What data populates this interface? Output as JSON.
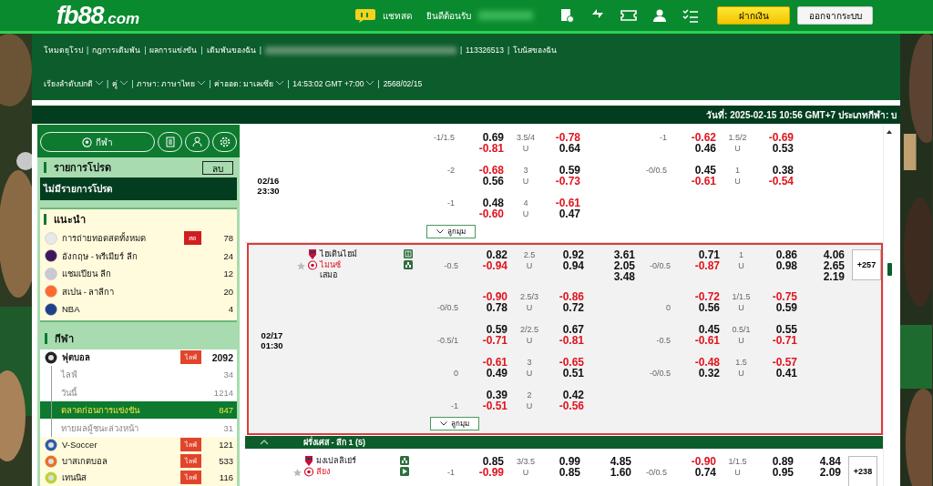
{
  "header": {
    "logo": "fb88",
    "logo_suffix": ".com",
    "chat": "แชทสด",
    "welcome": "ยินดีต้อนรับ",
    "buttons": [
      {
        "label": "ฝากเงิน",
        "kind": "primary"
      },
      {
        "label": "ออกจากระบบ",
        "kind": "plain"
      }
    ]
  },
  "info_bar": {
    "separator": "|",
    "links": [
      {
        "label": "โหมดยุโรป",
        "kind": "link"
      },
      {
        "label": "กฎการเดิมพัน",
        "kind": "link"
      },
      {
        "label": "ผลการแข่งขัน",
        "kind": "link"
      },
      {
        "label": "เดิมพันของฉัน",
        "kind": "link"
      },
      {
        "kind": "blurred"
      },
      {
        "label": "113326513",
        "kind": "link"
      },
      {
        "label": "โบนัสของฉัน",
        "kind": "link"
      }
    ],
    "settings": [
      {
        "label": "เรียงลำดับปกติ",
        "kind": "dropdown"
      },
      {
        "label": "คู่",
        "kind": "dropdown"
      },
      {
        "label": "ภาษา: ภาษาไทย",
        "kind": "dropdown"
      },
      {
        "label": "ค่าออด: มาเลเซีย",
        "kind": "dropdown"
      },
      {
        "label": "14:53:02 GMT +7:00",
        "kind": "dropdown"
      },
      {
        "label": "2568/02/15",
        "kind": "text"
      }
    ]
  },
  "date_bar": "วันที่: 2025-02-15 10:56 GMT+7 ประเภทกีฬา: บ",
  "sidebar": {
    "sports_button": "กีฬา",
    "favorites": {
      "title": "รายการโปรด",
      "clear_button": "ลบ",
      "empty_text": "ไม่มีรายการโปรด"
    },
    "recommended": {
      "title": "แนะนำ",
      "items": [
        {
          "name": "การถ่ายทอดสดทั้งหมด",
          "count": "78",
          "badge": "สด"
        },
        {
          "name": "อังกฤษ - พรีเมียร์ ลีก",
          "count": "24"
        },
        {
          "name": "แชมเปียน ลีก",
          "count": "12"
        },
        {
          "name": "สเปน - ลาลีกา",
          "count": "20"
        },
        {
          "name": "NBA",
          "count": "4"
        }
      ]
    },
    "sports": {
      "title": "กีฬา",
      "items": [
        {
          "name": "ฟุตบอล",
          "count": "2092",
          "badge": "ไลฟ์",
          "expanded": true,
          "children": [
            {
              "name": "ไลฟ์",
              "count": "34",
              "selected": false
            },
            {
              "name": "วันนี้",
              "count": "1214",
              "selected": false
            },
            {
              "name": "ตลาดก่อนการแข่งขัน",
              "count": "847",
              "selected": true
            },
            {
              "name": "ทายผลผู้ชนะล่วงหน้า",
              "count": "31",
              "selected": false
            }
          ]
        },
        {
          "name": "V-Soccer",
          "count": "121",
          "badge": "ไลฟ์",
          "expanded": false
        },
        {
          "name": "บาสเกตบอล",
          "count": "533",
          "badge": "ไลฟ์",
          "expanded": false
        },
        {
          "name": "เทนนิส",
          "count": "116",
          "badge": "ไลฟ์",
          "expanded": false
        }
      ]
    }
  },
  "main": {
    "items": [
      {
        "kind": "match",
        "date": "02/16",
        "time": "23:30",
        "away_favoured": false,
        "highlighted": false,
        "more_markets": "ลูกมุม",
        "lines": [
          {
            "hdp": "-1/1.5",
            "odds": [
              "0.69",
              "-0.81"
            ],
            "ou": "3.5/4",
            "ou_side": "U",
            "ou_odds": [
              "-0.78",
              "0.64"
            ],
            "h1_hdp": "-1",
            "h1_odds": [
              "-0.62",
              "0.46"
            ],
            "h1_ou": "1.5/2",
            "h1_ou_side": "U",
            "h1_ou_odds": [
              "-0.69",
              "0.53"
            ]
          },
          {
            "hdp": "-2",
            "odds": [
              "-0.68",
              "0.56"
            ],
            "ou": "3",
            "ou_side": "U",
            "ou_odds": [
              "0.59",
              "-0.73"
            ],
            "h1_hdp": "-0/0.5",
            "h1_odds": [
              "0.45",
              "-0.61"
            ],
            "h1_ou": "1",
            "h1_ou_side": "U",
            "h1_ou_odds": [
              "0.38",
              "-0.54"
            ]
          },
          {
            "hdp": "-1",
            "odds": [
              "0.48",
              "-0.60"
            ],
            "ou": "4",
            "ou_side": "U",
            "ou_odds": [
              "-0.61",
              "0.47"
            ]
          }
        ]
      },
      {
        "kind": "match",
        "date": "02/17",
        "time": "01:30",
        "away_favoured": true,
        "highlighted": true,
        "home": "ไฮเดินไฮม์",
        "away": "ไมนซ์",
        "draw": "เสมอ",
        "icons": [
          {
            "kind": "field"
          },
          {
            "kind": "stats"
          }
        ],
        "more": "+257",
        "more_markets": "ลูกมุม",
        "lines": [
          {
            "hdp": "-0.5",
            "odds": [
              "0.82",
              "-0.94"
            ],
            "ou": "2.5",
            "ou_side": "U",
            "ou_odds": [
              "0.92",
              "0.94"
            ],
            "x12": [
              "3.61",
              "2.05",
              "3.48"
            ],
            "h1_hdp": "-0/0.5",
            "h1_odds": [
              "0.71",
              "-0.87"
            ],
            "h1_ou": "1",
            "h1_ou_side": "U",
            "h1_ou_odds": [
              "0.86",
              "0.98"
            ],
            "h1_x12": [
              "4.06",
              "2.65",
              "2.19"
            ]
          },
          {
            "hdp": "-0/0.5",
            "odds": [
              "-0.90",
              "0.78"
            ],
            "ou": "2.5/3",
            "ou_side": "U",
            "ou_odds": [
              "-0.86",
              "0.72"
            ],
            "h1_hdp": "0",
            "h1_odds": [
              "-0.72",
              "0.56"
            ],
            "h1_ou": "1/1.5",
            "h1_ou_side": "U",
            "h1_ou_odds": [
              "-0.75",
              "0.59"
            ]
          },
          {
            "hdp": "-0.5/1",
            "odds": [
              "0.59",
              "-0.71"
            ],
            "ou": "2/2.5",
            "ou_side": "U",
            "ou_odds": [
              "0.67",
              "-0.81"
            ],
            "h1_hdp": "-0.5",
            "h1_odds": [
              "0.45",
              "-0.61"
            ],
            "h1_ou": "0.5/1",
            "h1_ou_side": "U",
            "h1_ou_odds": [
              "0.55",
              "-0.71"
            ]
          },
          {
            "hdp": "0",
            "odds": [
              "-0.61",
              "0.49"
            ],
            "ou": "3",
            "ou_side": "U",
            "ou_odds": [
              "-0.65",
              "0.51"
            ],
            "h1_hdp": "-0/0.5",
            "h1_odds": [
              "-0.48",
              "0.32"
            ],
            "h1_ou": "1.5",
            "h1_ou_side": "U",
            "h1_ou_odds": [
              "-0.57",
              "0.41"
            ]
          },
          {
            "hdp": "-1",
            "odds": [
              "0.39",
              "-0.51"
            ],
            "ou": "2",
            "ou_side": "U",
            "ou_odds": [
              "0.42",
              "-0.56"
            ]
          }
        ]
      },
      {
        "kind": "league",
        "title": "ฝรั่งเศส - ลีก 1 (5)",
        "expanded": true
      },
      {
        "kind": "match",
        "away_favoured": true,
        "highlighted": false,
        "home": "มงเปลลิเย่ร์",
        "away": "ลียง",
        "icons": [
          {
            "kind": "stats"
          },
          {
            "kind": "video"
          }
        ],
        "more": "+238",
        "lines": [
          {
            "hdp": "-1",
            "odds": [
              "0.85",
              "-0.99"
            ],
            "ou": "3/3.5",
            "ou_side": "U",
            "ou_odds": [
              "0.99",
              "0.85"
            ],
            "x12": [
              "4.85",
              "1.60"
            ],
            "h1_hdp": "-0/0.5",
            "h1_odds": [
              "-0.90",
              "0.74"
            ],
            "h1_ou": "1/1.5",
            "h1_ou_side": "U",
            "h1_ou_odds": [
              "0.89",
              "0.95"
            ],
            "h1_x12": [
              "4.84",
              "2.09"
            ]
          }
        ]
      }
    ]
  }
}
